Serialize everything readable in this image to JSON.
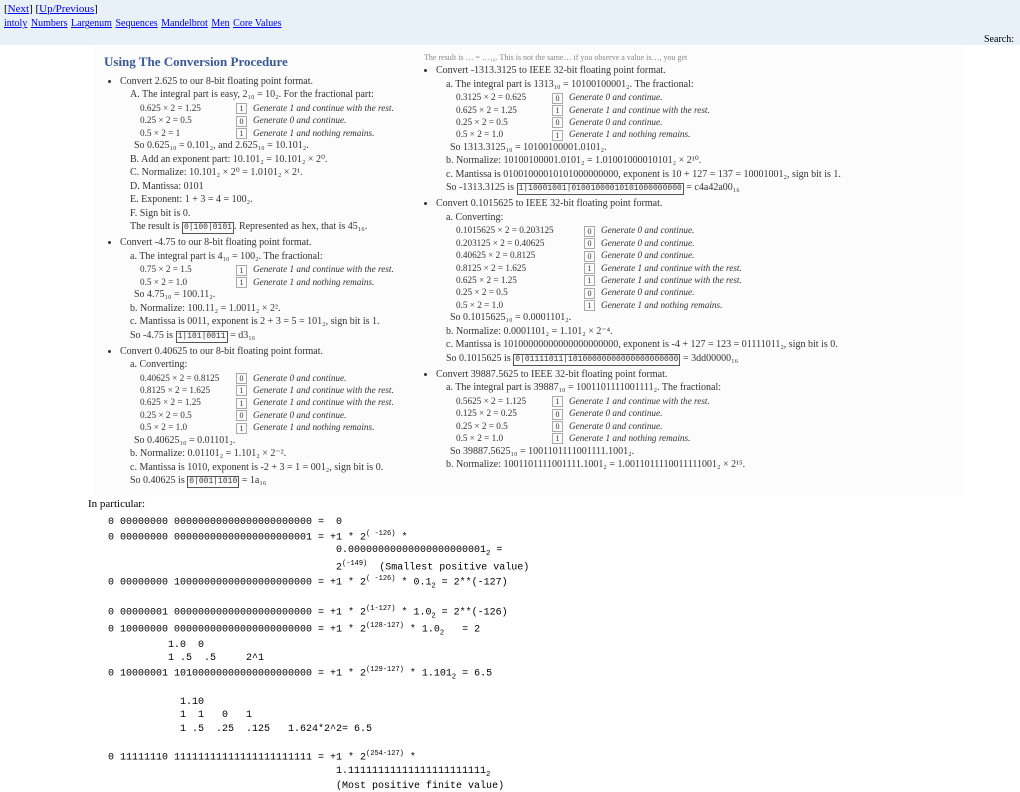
{
  "nav": {
    "next": "Next",
    "up": "Up/Previous",
    "crumbs": [
      "intoly",
      "Numbers",
      "Largenum",
      "Sequences",
      "Mandelbrot",
      "Men",
      "Core Values"
    ],
    "search_label": "Search:"
  },
  "left": {
    "title": "Using The Conversion Procedure",
    "b1": "Convert 2.625 to our 8-bit floating point format.",
    "b1a": "The integral part is easy, 2₁₀ = 10₂. For the fractional part:",
    "t1": [
      [
        "0.625 × 2 = 1.25",
        "1",
        "Generate 1 and continue with the rest."
      ],
      [
        "0.25  × 2 = 0.5",
        "0",
        "Generate 0 and continue."
      ],
      [
        "0.5   × 2 = 1",
        "1",
        "Generate 1 and nothing remains."
      ]
    ],
    "b1a2": "So 0.625₁₀ = 0.101₂, and 2.625₁₀ = 10.101₂.",
    "b1b": "Add an exponent part: 10.101₂ = 10.101₂ × 2⁰.",
    "b1c": "Normalize: 10.101₂ × 2⁰ = 1.0101₂ × 2¹.",
    "b1d": "Mantissa: 0101",
    "b1e": "Exponent: 1 + 3 = 4 = 100₂.",
    "b1f": "Sign bit is 0.",
    "b1r": "The result is ",
    "b1rbox": "0|100|0101",
    "b1r2": ". Represented as hex, that is 45₁₆.",
    "b2": "Convert -4.75 to our 8-bit floating point format.",
    "b2a": "The integral part is 4₁₀ = 100₂. The fractional:",
    "t2": [
      [
        "0.75 × 2 = 1.5",
        "1",
        "Generate 1 and continue with the rest."
      ],
      [
        "0.5  × 2 = 1.0",
        "1",
        "Generate 1 and nothing remains."
      ]
    ],
    "b2a2": "So 4.75₁₀ = 100.11₂.",
    "b2b": "Normalize: 100.11₂ = 1.0011₂ × 2².",
    "b2c": "Mantissa is 0011, exponent is 2 + 3 = 5 = 101₂, sign bit is 1.",
    "b2r": "So -4.75 is ",
    "b2rbox": "1|101|0011",
    "b2r2": " = d3₁₆",
    "b3": "Convert 0.40625 to our 8-bit floating point format.",
    "b3a": "Converting:",
    "t3": [
      [
        "0.40625 × 2 = 0.8125",
        "0",
        "Generate 0 and continue."
      ],
      [
        "0.8125  × 2 = 1.625",
        "1",
        "Generate 1 and continue with the rest."
      ],
      [
        "0.625   × 2 = 1.25",
        "1",
        "Generate 1 and continue with the rest."
      ],
      [
        "0.25    × 2 = 0.5",
        "0",
        "Generate 0 and continue."
      ],
      [
        "0.5     × 2 = 1.0",
        "1",
        "Generate 1 and nothing remains."
      ]
    ],
    "b3a2": "So 0.40625₁₀ = 0.01101₂.",
    "b3b": "Normalize: 0.01101₂ = 1.101₂ × 2⁻².",
    "b3c": "Mantissa is 1010, exponent is -2 + 3 = 1 = 001₂, sign bit is 0.",
    "b3r": "So 0.40625 is ",
    "b3rbox": "0|001|1010",
    "b3r2": " = 1a₁₆"
  },
  "right": {
    "top": "The result is … = …₁₆. This is not the same… if you observe a value is…, you get",
    "b1": "Convert -1313.3125 to IEEE 32-bit floating point format.",
    "b1a": "The integral part is 1313₁₀ = 10100100001₂. The fractional:",
    "t1": [
      [
        "0.3125 × 2 = 0.625",
        "0",
        "Generate 0 and continue."
      ],
      [
        "0.625  × 2 = 1.25",
        "1",
        "Generate 1 and continue with the rest."
      ],
      [
        "0.25   × 2 = 0.5",
        "0",
        "Generate 0 and continue."
      ],
      [
        "0.5    × 2 = 1.0",
        "1",
        "Generate 1 and nothing remains."
      ]
    ],
    "b1a2": "So 1313.3125₁₀ = 10100100001.0101₂.",
    "b1b": "Normalize: 10100100001.0101₂ = 1.01001000010101₂ × 2¹⁰.",
    "b1c": "Mantissa is 01001000010101000000000, exponent is 10 + 127 = 137 = 10001001₂, sign bit is 1.",
    "b1r": "So -1313.3125 is ",
    "b1rbox": "1|10001001|01001000010101000000000",
    "b1r2": " = c4a42a00₁₆",
    "b2": "Convert 0.1015625 to IEEE 32-bit floating point format.",
    "b2a": "Converting:",
    "t2": [
      [
        "0.1015625 × 2 = 0.203125",
        "0",
        "Generate 0 and continue."
      ],
      [
        "0.203125  × 2 = 0.40625",
        "0",
        "Generate 0 and continue."
      ],
      [
        "0.40625   × 2 = 0.8125",
        "0",
        "Generate 0 and continue."
      ],
      [
        "0.8125    × 2 = 1.625",
        "1",
        "Generate 1 and continue with the rest."
      ],
      [
        "0.625     × 2 = 1.25",
        "1",
        "Generate 1 and continue with the rest."
      ],
      [
        "0.25      × 2 = 0.5",
        "0",
        "Generate 0 and continue."
      ],
      [
        "0.5       × 2 = 1.0",
        "1",
        "Generate 1 and nothing remains."
      ]
    ],
    "b2a2": "So 0.1015625₁₀ = 0.0001101₂.",
    "b2b": "Normalize: 0.0001101₂ = 1.101₂ × 2⁻⁴.",
    "b2c": "Mantissa is 10100000000000000000000, exponent is -4 + 127 = 123 = 01111011₂, sign bit is 0.",
    "b2r": "So 0.1015625 is ",
    "b2rbox": "0|01111011|10100000000000000000000",
    "b2r2": " = 3dd00000₁₆",
    "b3": "Convert 39887.5625 to IEEE 32-bit floating point format.",
    "b3a": "The integral part is 39887₁₀ = 1001101111001111₂. The fractional:",
    "t3": [
      [
        "0.5625 × 2 = 1.125",
        "1",
        "Generate 1 and continue with the rest."
      ],
      [
        "0.125  × 2 = 0.25",
        "0",
        "Generate 0 and continue."
      ],
      [
        "0.25   × 2 = 0.5",
        "0",
        "Generate 0 and continue."
      ],
      [
        "0.5    × 2 = 1.0",
        "1",
        "Generate 1 and nothing remains."
      ]
    ],
    "b3a2": "So 39887.5625₁₀ = 1001101111001111.1001₂.",
    "b3b": "Normalize: 1001101111001111.1001₂ = 1.0011011110011111001₂ × 2¹⁵."
  },
  "particular": "In particular:",
  "pre_lines": {
    "l1a": "0 00000000 00000000000000000000000 =  0",
    "l2a": "0 00000000 00000000000000000000001 = +1 * 2",
    "l2sup": "( -126)",
    "l2b": " *",
    "l3": "                                      0.00000000000000000000001",
    "l3sub": "2",
    "l3b": " =",
    "l4a": "                                      2",
    "l4sup": "(-149)",
    "l4b": "  (Smallest positive value)",
    "l5a": "0 00000000 10000000000000000000000 = +1 * 2",
    "l5sup": "( -126)",
    "l5b": " * 0.1",
    "l5sub": "2",
    "l5c": " = 2**(-127)",
    "l6a": "0 00000001 00000000000000000000000 = +1 * 2",
    "l6sup": "(1-127)",
    "l6b": " * 1.0",
    "l6sub": "2",
    "l6c": " = 2**(-126)",
    "l7a": "0 10000000 00000000000000000000000 = +1 * 2",
    "l7sup": "(128-127)",
    "l7b": " * 1.0",
    "l7sub": "2",
    "l7c": "   = 2",
    "l8": "          1.0  0",
    "l9": "          1 .5  .5     2^1",
    "l10a": "0 10000001 10100000000000000000000 = +1 * 2",
    "l10sup": "(129-127)",
    "l10b": " * 1.101",
    "l10sub": "2",
    "l10c": " = 6.5",
    "l11": "",
    "l12": "            1.10",
    "l13": "            1  1   0   1",
    "l14": "            1 .5  .25  .125   1.624*2^2= 6.5",
    "l15": "",
    "l16a": "0 11111110 11111111111111111111111 = +1 * 2",
    "l16sup": "(254-127)",
    "l16b": " *",
    "l17a": "                                      1.11111111111111111111111",
    "l17sub": "2",
    "l18": "                                      (Most positive finite value)"
  }
}
